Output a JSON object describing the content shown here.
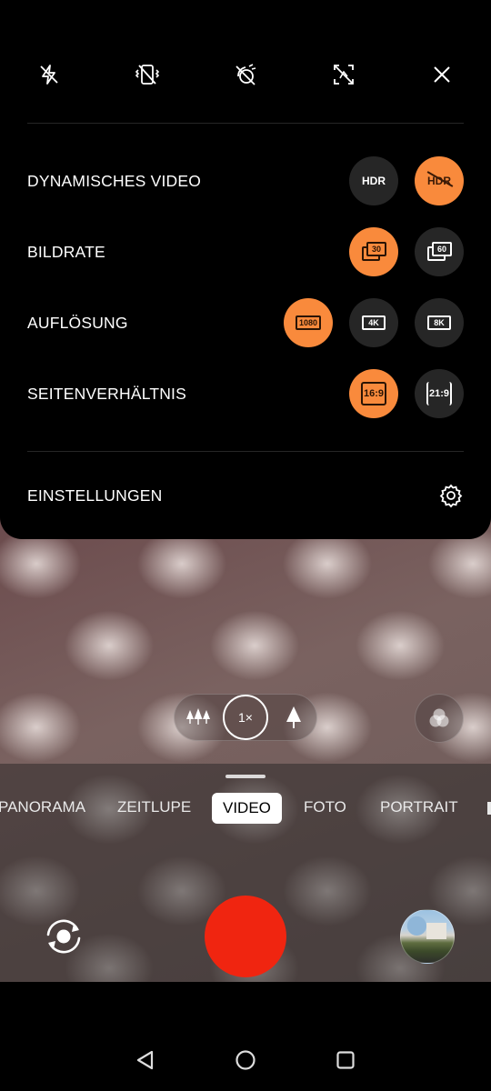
{
  "settings": {
    "rows": [
      {
        "label": "DYNAMISCHES VIDEO",
        "options": [
          {
            "text": "HDR",
            "active": false
          },
          {
            "text": "HDR",
            "active": true,
            "crossed": true
          }
        ]
      },
      {
        "label": "BILDRATE",
        "options": [
          {
            "text": "30",
            "active": true
          },
          {
            "text": "60",
            "active": false
          }
        ]
      },
      {
        "label": "AUFLÖSUNG",
        "options": [
          {
            "text": "1080",
            "active": true
          },
          {
            "text": "4K",
            "active": false
          },
          {
            "text": "8K",
            "active": false
          }
        ]
      },
      {
        "label": "SEITENVERHÄLTNIS",
        "options": [
          {
            "text": "16:9",
            "active": true
          },
          {
            "text": "21:9",
            "active": false
          }
        ]
      }
    ],
    "settings_label": "EINSTELLUNGEN"
  },
  "top_icons": [
    "flash-off-icon",
    "vibration-off-icon",
    "stabilization-off-icon",
    "timer-off-icon",
    "close-icon"
  ],
  "zoom": {
    "current": "1×"
  },
  "modes": [
    "PANORAMA",
    "ZEITLUPE",
    "VIDEO",
    "FOTO",
    "PORTRAIT"
  ],
  "active_mode": "VIDEO",
  "colors": {
    "accent": "#f98a3c",
    "record": "#f02510",
    "option_bg": "#262626"
  }
}
